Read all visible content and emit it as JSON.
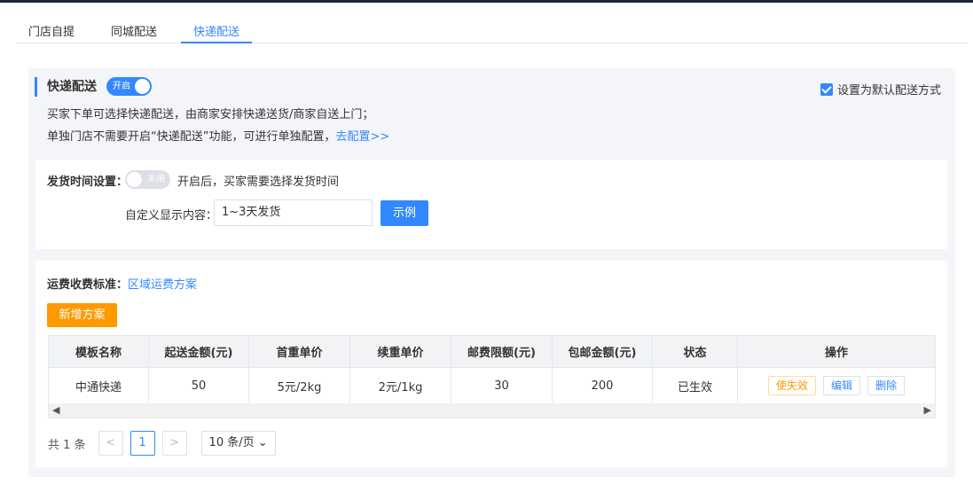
{
  "tabs": [
    {
      "label": "门店自提"
    },
    {
      "label": "同城配送"
    },
    {
      "label": "快递配送"
    }
  ],
  "section": {
    "title": "快递配送",
    "enabled_label": "开启",
    "default_label": "设置为默认配送方式",
    "desc1": "买家下单可选择快递配送，由商家安排快递送货/商家自送上门；",
    "desc2_prefix": "单独门店不需要开启“快递配送”功能，可进行单独配置，",
    "desc2_link": "去配置>>"
  },
  "ship_time": {
    "label": "发货时间设置：",
    "toggle_label": "关闭",
    "hint": "开启后，买家需要选择发货时间",
    "custom_label": "自定义显示内容：",
    "custom_value": "1~3天发货",
    "example_button": "示例"
  },
  "fee": {
    "label": "运费收费标准：",
    "link": "区域运费方案",
    "add_button": "新增方案"
  },
  "table": {
    "headers": [
      "模板名称",
      "起送金额(元)",
      "首重单价",
      "续重单价",
      "邮费限额(元)",
      "包邮金额(元)",
      "状态",
      "操作"
    ],
    "rows": [
      {
        "name": "中通快递",
        "min": "50",
        "first": "5元/2kg",
        "next": "2元/1kg",
        "limit": "30",
        "free": "200",
        "status": "已生效",
        "ops": [
          "使失效",
          "编辑",
          "删除"
        ]
      }
    ]
  },
  "pager": {
    "total": "共 1 条",
    "prev": "<",
    "current": "1",
    "next": ">",
    "size": "10 条/页"
  },
  "colors": {
    "accent": "#3388ff",
    "orange": "#ff9900",
    "panel_bg": "#f4f5f8"
  }
}
